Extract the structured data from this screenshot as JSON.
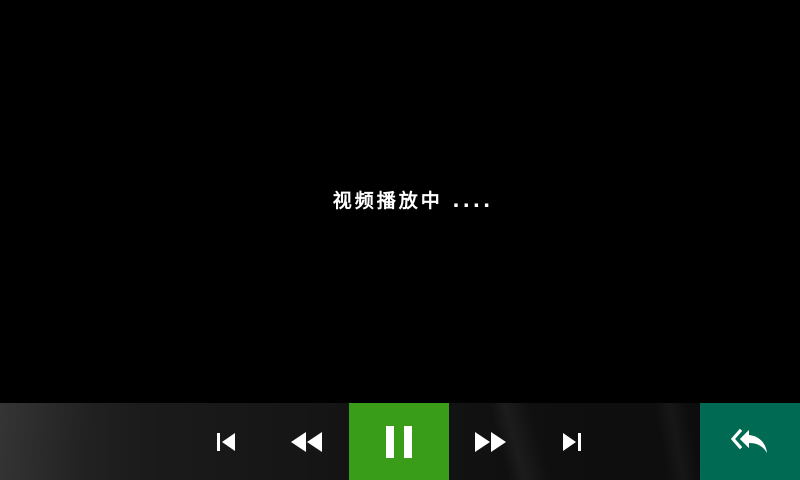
{
  "player": {
    "status_text": "视频播放中 ...."
  },
  "controls": {
    "prev_icon": "skip-previous-icon",
    "rewind_icon": "rewind-icon",
    "pause_icon": "pause-icon",
    "forward_icon": "fast-forward-icon",
    "next_icon": "skip-next-icon",
    "back_icon": "reply-all-back-icon"
  },
  "colors": {
    "pause_active": "#3a9d1a",
    "back_button": "#006a52",
    "text": "#ffffff",
    "background": "#000000"
  }
}
